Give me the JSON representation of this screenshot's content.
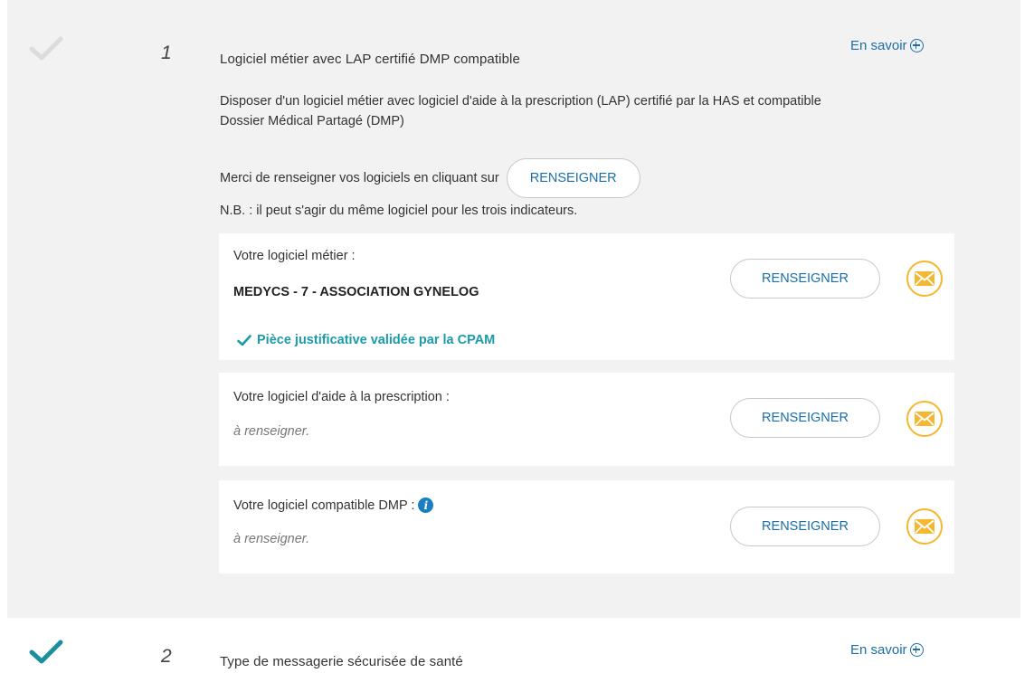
{
  "section1": {
    "number": "1",
    "title": "Logiciel métier avec LAP certifié DMP compatible",
    "en_savoir": "En savoir",
    "description": "Disposer d'un logiciel métier avec logiciel d'aide à la prescription (LAP) certifié par la HAS et compatible Dossier Médical Partagé (DMP)",
    "instruction": "Merci de renseigner vos logiciels en cliquant sur",
    "renseigner_label": "RENSEIGNER",
    "note": "N.B. : il peut s'agir du même logiciel pour les trois indicateurs.",
    "cards": [
      {
        "label": "Votre logiciel métier :",
        "value": "MEDYCS - 7 - ASSOCIATION GYNELOG",
        "validated": "Pièce justificative validée par la CPAM",
        "button": "RENSEIGNER"
      },
      {
        "label": "Votre logiciel d'aide à la prescription :",
        "placeholder": "à renseigner.",
        "button": "RENSEIGNER"
      },
      {
        "label": "Votre logiciel compatible DMP :",
        "placeholder": "à renseigner.",
        "button": "RENSEIGNER",
        "info_icon": "i"
      }
    ]
  },
  "section2": {
    "number": "2",
    "title": "Type de messagerie sécurisée de santé",
    "en_savoir": "En savoir"
  },
  "colors": {
    "accent": "#1a6fa8",
    "validated": "#1a9bab",
    "mail": "#f5b731",
    "check_done": "#1a8fa0",
    "check_inactive": "#dcdcdc"
  }
}
